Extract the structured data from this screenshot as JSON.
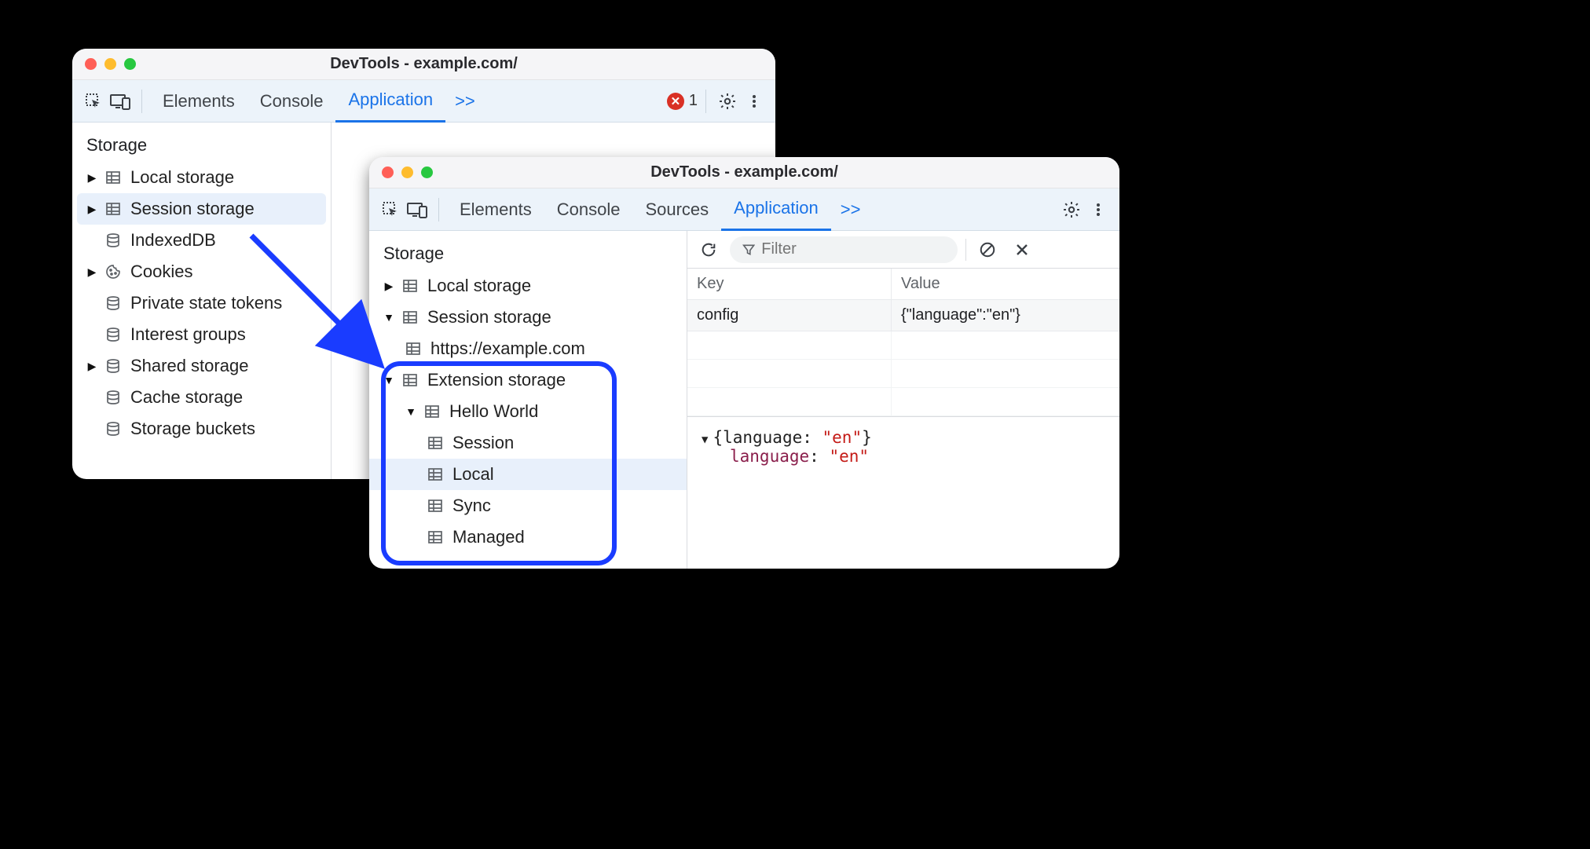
{
  "window1": {
    "title": "DevTools - example.com/",
    "tabs": {
      "elements": "Elements",
      "console": "Console",
      "application": "Application"
    },
    "more": ">>",
    "error_count": "1",
    "storage_header": "Storage",
    "items": {
      "local": "Local storage",
      "session": "Session storage",
      "indexed": "IndexedDB",
      "cookies": "Cookies",
      "pst": "Private state tokens",
      "ig": "Interest groups",
      "shared": "Shared storage",
      "cache": "Cache storage",
      "buckets": "Storage buckets"
    }
  },
  "window2": {
    "title": "DevTools - example.com/",
    "tabs": {
      "elements": "Elements",
      "console": "Console",
      "sources": "Sources",
      "application": "Application"
    },
    "more": ">>",
    "storage_header": "Storage",
    "filter_placeholder": "Filter",
    "items": {
      "local": "Local storage",
      "session": "Session storage",
      "session_child": "https://example.com",
      "ext": "Extension storage",
      "hello": "Hello World",
      "h_session": "Session",
      "h_local": "Local",
      "h_sync": "Sync",
      "h_managed": "Managed"
    },
    "table": {
      "key_h": "Key",
      "val_h": "Value",
      "row_key": "config",
      "row_val": "{\"language\":\"en\"}"
    },
    "json": {
      "line1_pre": "{language: ",
      "line1_val": "\"en\"",
      "line1_post": "}",
      "line2_k": "language",
      "line2_sep": ": ",
      "line2_v": "\"en\""
    }
  }
}
